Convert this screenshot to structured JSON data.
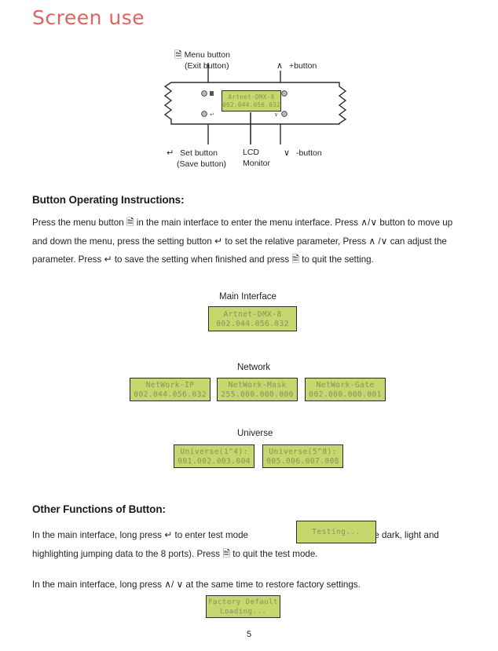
{
  "title": "Screen use",
  "diagram": {
    "labels": {
      "menu_button": "Menu button",
      "menu_button_alt": "(Exit button)",
      "plus_button": "+button",
      "set_button": "Set button",
      "set_button_alt": "(Save button)",
      "lcd_monitor_line1": "LCD",
      "lcd_monitor_line2": "Monitor",
      "minus_button": "-button"
    },
    "icons": {
      "menu": "document-icon",
      "up": "chevron-up-icon",
      "down": "chevron-down-icon",
      "enter": "enter-arrow-icon"
    },
    "device_lcd": {
      "line1": "Artnet-DMX-8",
      "line2": "002.044.056.032"
    }
  },
  "sections": {
    "instructions": {
      "heading": "Button Operating Instructions:",
      "text_1": "Press the menu button",
      "text_2": "in the main interface to enter the menu interface. Press",
      "text_3": "/",
      "text_4": "button to move up and down the menu, press the setting button",
      "text_5": "to  set the relative parameter,",
      "text_6": "Press",
      "text_7": "/",
      "text_8": "can adjust the parameter.  Press",
      "text_9": "to save the setting when finished and press",
      "text_10": "to quit the setting."
    },
    "other_functions": {
      "heading": "Other Functions of Button:",
      "p1_a": "In the main interface, long press",
      "p1_b": "to enter test mode",
      "p1_c": "(send the dark, light",
      "p1_d": "and highlighting jumping data to the 8 ports). Press",
      "p1_e": "to quit the test mode.",
      "p2_a": "In the main interface, long press",
      "p2_b": "/",
      "p2_c": "at the same time to restore factory settings."
    }
  },
  "screens": {
    "main_interface": {
      "title": "Main Interface",
      "line1": "Artnet-DMX-8",
      "line2": "002.044.056.032"
    },
    "network": {
      "title": "Network",
      "items": [
        {
          "line1": "NetWork-IP",
          "line2": "002.044.056.032"
        },
        {
          "line1": "NetWork-Mask",
          "line2": "255.000.000.000"
        },
        {
          "line1": "NetWork-Gate",
          "line2": "002.000.000.001"
        }
      ]
    },
    "universe": {
      "title": "Universe",
      "items": [
        {
          "line1": "Universe(1^4):",
          "line2": "001.002.003.004"
        },
        {
          "line1": "Universe(5^8):",
          "line2": "005.006.007.008"
        }
      ]
    },
    "testing": {
      "line1": "Testing..."
    },
    "factory": {
      "line1": "Factory Default",
      "line2": "Loading..."
    }
  },
  "glyphs": {
    "up": "∧",
    "down": "∨",
    "enter": "↵",
    "doc": "☰"
  },
  "page_number": "5",
  "colors": {
    "title": "#e0625f",
    "lcd_background": "#c8d76d",
    "lcd_text": "#8d9a63",
    "body_text": "#231f20"
  }
}
